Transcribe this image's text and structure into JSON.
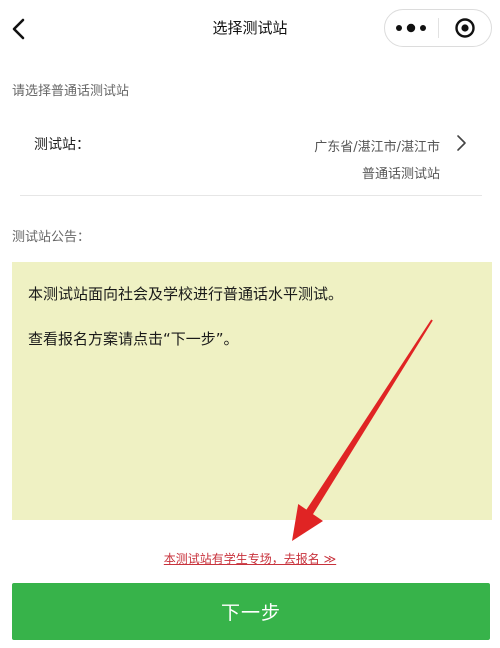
{
  "nav": {
    "title": "选择测试站",
    "back_icon": "chevron-left-icon",
    "more_icon": "more-dots-icon",
    "close_icon": "record-target-icon"
  },
  "section_select": {
    "label": "请选择普通话测试站"
  },
  "station_row": {
    "label": "测试站：",
    "value_line1": "广东省/湛江市/湛江市",
    "value_line2": "普通话测试站",
    "chevron_icon": "chevron-right-icon"
  },
  "notice": {
    "label": "测试站公告：",
    "lines": [
      "本测试站面向社会及学校进行普通话水平测试。",
      "查看报名方案请点击“下一步”。"
    ]
  },
  "student_link": {
    "text": "本测试站有学生专场，去报名 ≫"
  },
  "next_button": {
    "label": "下一步"
  },
  "annotation": {
    "icon": "red-arrow-icon"
  },
  "colors": {
    "notice_background": "#eff1c3",
    "link": "#c8323c",
    "button": "#37b34a",
    "annotation_arrow": "#e02424"
  }
}
